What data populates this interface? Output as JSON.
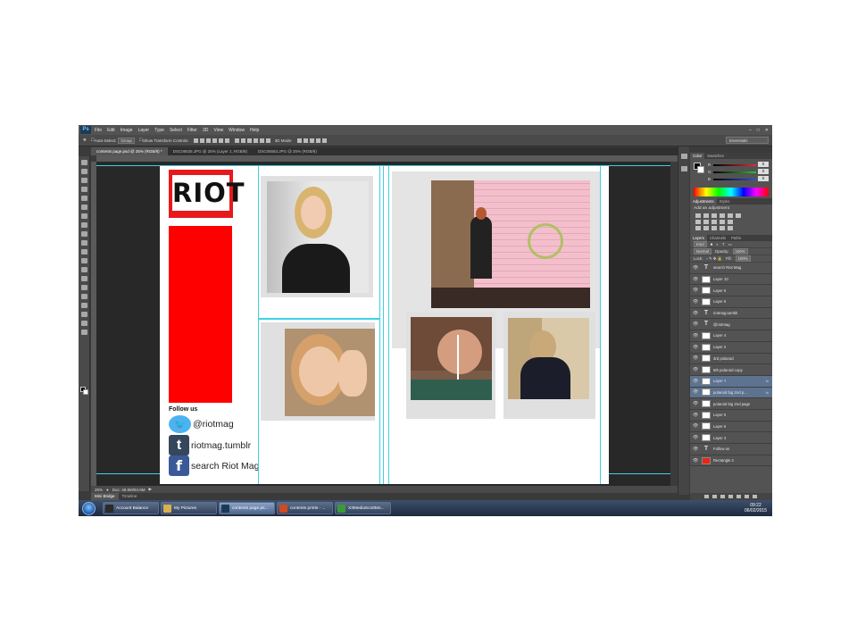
{
  "menubar": {
    "app_logo": "Ps",
    "items": [
      "File",
      "Edit",
      "Image",
      "Layer",
      "Type",
      "Select",
      "Filter",
      "3D",
      "View",
      "Window",
      "Help"
    ]
  },
  "options_bar": {
    "auto_select_label": "Auto-Select:",
    "auto_select_value": "Group",
    "transform_label": "Show Transform Controls",
    "mode_label": "3D Mode:",
    "workspace": "Essentials"
  },
  "doc_tabs": [
    {
      "label": "contents page.psd @ 25% (RGB/8) *",
      "active": true
    },
    {
      "label": "DSC06535.JPG @ 25% (Layer 1, RGB/8)",
      "active": false
    },
    {
      "label": "DSC06583.JPG @ 25% (RGB/8)",
      "active": false
    }
  ],
  "document": {
    "logo_text": "RIOT",
    "follow_title": "Follow us",
    "social": [
      {
        "icon": "twitter-icon",
        "glyph": "🐦",
        "text": "@riotmag"
      },
      {
        "icon": "tumblr-icon",
        "glyph": "t",
        "text": "riotmag.tumblr"
      },
      {
        "icon": "facebook-icon",
        "glyph": "f",
        "text": "search Riot Mag"
      }
    ]
  },
  "status": {
    "zoom": "25%",
    "doc_size": "Doc: 48.8M/94.6M"
  },
  "bottom_tabs": [
    {
      "label": "Mini Bridge",
      "active": true
    },
    {
      "label": "Timeline",
      "active": false
    }
  ],
  "panels": {
    "color_tabs": [
      "Color",
      "Swatches"
    ],
    "color_channels": [
      {
        "label": "R",
        "value": "0",
        "color": "#e03030"
      },
      {
        "label": "G",
        "value": "0",
        "color": "#30c030"
      },
      {
        "label": "B",
        "value": "0",
        "color": "#3050e0"
      }
    ],
    "adjust_tabs": [
      "Adjustments",
      "Styles"
    ],
    "adjust_title": "Add an adjustment",
    "layer_tabs": [
      "Layers",
      "Channels",
      "Paths"
    ],
    "kind_label": "Kind",
    "blend_mode": "Normal",
    "opacity_label": "Opacity:",
    "opacity_value": "100%",
    "lock_label": "Lock:",
    "fill_label": "Fill:",
    "fill_value": "100%",
    "layers": [
      {
        "name": "search Riot Mag",
        "type": "text",
        "selected": false,
        "fx": false
      },
      {
        "name": "Layer 10",
        "type": "image",
        "selected": false,
        "fx": false
      },
      {
        "name": "Layer 9",
        "type": "image",
        "selected": false,
        "fx": false
      },
      {
        "name": "Layer 8",
        "type": "image",
        "selected": false,
        "fx": false
      },
      {
        "name": "riotmag.tumblr",
        "type": "text",
        "selected": false,
        "fx": false
      },
      {
        "name": "@riotmag",
        "type": "text",
        "selected": false,
        "fx": false
      },
      {
        "name": "Layer 4",
        "type": "image",
        "selected": false,
        "fx": false
      },
      {
        "name": "Layer 2",
        "type": "image",
        "selected": false,
        "fx": false
      },
      {
        "name": "3rd polaroid",
        "type": "image",
        "selected": false,
        "fx": false
      },
      {
        "name": "5th polaroid copy",
        "type": "image",
        "selected": false,
        "fx": false
      },
      {
        "name": "Layer 7",
        "type": "image",
        "selected": true,
        "fx": true
      },
      {
        "name": "polaroid big 2nd p...",
        "type": "image",
        "selected": true,
        "fx": true
      },
      {
        "name": "polaroid big 2nd page",
        "type": "image",
        "selected": false,
        "fx": false
      },
      {
        "name": "Layer 5",
        "type": "image",
        "selected": false,
        "fx": false
      },
      {
        "name": "Layer 6",
        "type": "image",
        "selected": false,
        "fx": false
      },
      {
        "name": "Layer 3",
        "type": "image",
        "selected": false,
        "fx": false
      },
      {
        "name": "Follow us",
        "type": "text",
        "selected": false,
        "fx": false
      },
      {
        "name": "Rectangle 2",
        "type": "shape",
        "selected": false,
        "fx": false
      }
    ]
  },
  "taskbar": {
    "buttons": [
      {
        "label": "Account Balance",
        "icon": "account-icon",
        "color": "#2a2a2a",
        "active": false
      },
      {
        "label": "My Pictures",
        "icon": "folder-icon",
        "color": "#d8b050",
        "active": false
      },
      {
        "label": "contents page.ps...",
        "icon": "photoshop-icon",
        "color": "#1c3a55",
        "active": true
      },
      {
        "label": "contents prints - ...",
        "icon": "powerpoint-icon",
        "color": "#d04a20",
        "active": false
      },
      {
        "label": "X3MediaScottMo...",
        "icon": "chrome-icon",
        "color": "#3a9a3a",
        "active": false
      }
    ],
    "time": "09:22",
    "date": "06/02/2015"
  }
}
